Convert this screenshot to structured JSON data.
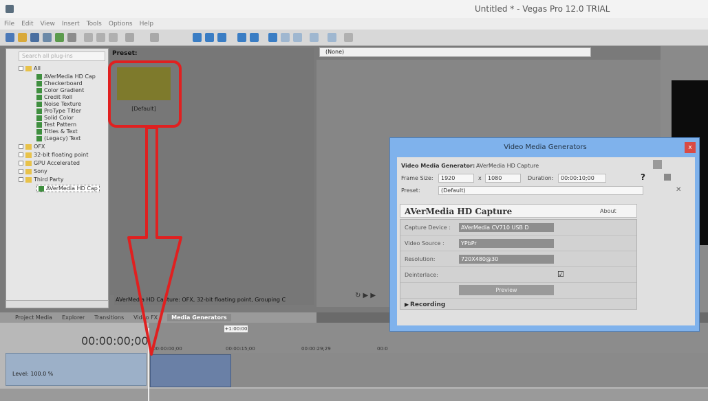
{
  "window": {
    "title": "Untitled * - Vegas Pro 12.0 TRIAL"
  },
  "menu": [
    "File",
    "Edit",
    "View",
    "Insert",
    "Tools",
    "Options",
    "Help"
  ],
  "explorer": {
    "search_placeholder": "Search all plug-ins",
    "tree": [
      {
        "label": "All",
        "type": "folder",
        "level": 0
      },
      {
        "label": "AVerMedia HD Cap",
        "type": "gen",
        "level": 1
      },
      {
        "label": "Checkerboard",
        "type": "gen",
        "level": 1
      },
      {
        "label": "Color Gradient",
        "type": "gen",
        "level": 1
      },
      {
        "label": "Credit Roll",
        "type": "gen",
        "level": 1
      },
      {
        "label": "Noise Texture",
        "type": "gen",
        "level": 1
      },
      {
        "label": "ProType Titler",
        "type": "gen",
        "level": 1
      },
      {
        "label": "Solid Color",
        "type": "gen",
        "level": 1
      },
      {
        "label": "Test Pattern",
        "type": "gen",
        "level": 1
      },
      {
        "label": "Titles & Text",
        "type": "gen",
        "level": 1
      },
      {
        "label": "(Legacy) Text",
        "type": "gen",
        "level": 1
      },
      {
        "label": "OFX",
        "type": "folder",
        "level": 0
      },
      {
        "label": "32-bit floating point",
        "type": "folder",
        "level": 0
      },
      {
        "label": "GPU Accelerated",
        "type": "folder",
        "level": 0
      },
      {
        "label": "Sony",
        "type": "folder",
        "level": 0
      },
      {
        "label": "Third Party",
        "type": "folder",
        "level": 0
      },
      {
        "label": "AVerMedia HD Cap",
        "type": "gen",
        "level": 1
      }
    ],
    "preset_label": "Preset:",
    "preset_name": "[Default]",
    "status": "AVerMedia HD Capture: OFX, 32-bit floating point, Grouping C",
    "tabs": [
      "Project Media",
      "Explorer",
      "Transitions",
      "Video FX",
      "Media Generators"
    ],
    "active_tab": "Media Generators"
  },
  "preview": {
    "dropdown": "(None)"
  },
  "timeline": {
    "timecode": "00:00:00;00",
    "ruler_marker": "+1:00:00",
    "ruler_labels": [
      "00:00:00;00",
      "00:00:15;00",
      "00:00:29;29",
      "00:0"
    ],
    "track_level": "Level: 100.0 %"
  },
  "dialog": {
    "title": "Video Media Generators",
    "close": "x",
    "generator_label": "Video Media Generator:",
    "generator_value": "AVerMedia HD Capture",
    "frame_size_label": "Frame Size:",
    "frame_w": "1920",
    "x_label": "x",
    "frame_h": "1080",
    "duration_label": "Duration:",
    "duration": "00:00:10;00",
    "preset_label": "Preset:",
    "preset_value": "(Default)",
    "plugin_title": "AVerMedia HD Capture",
    "about": "About",
    "capture_device_label": "Capture Device :",
    "capture_device": "AVerMedia CV710 USB D",
    "video_source_label": "Video Source :",
    "video_source": "YPbPr",
    "resolution_label": "Resolution:",
    "resolution": "720X480@30",
    "deinterlace_label": "Deinterlace:",
    "preview_label": "Preview",
    "recording_label": "Recording"
  },
  "colors": {
    "highlight": "#e02020",
    "dialog_frame": "#7fb2ec",
    "preset_swatch": "#7e7a2c"
  }
}
